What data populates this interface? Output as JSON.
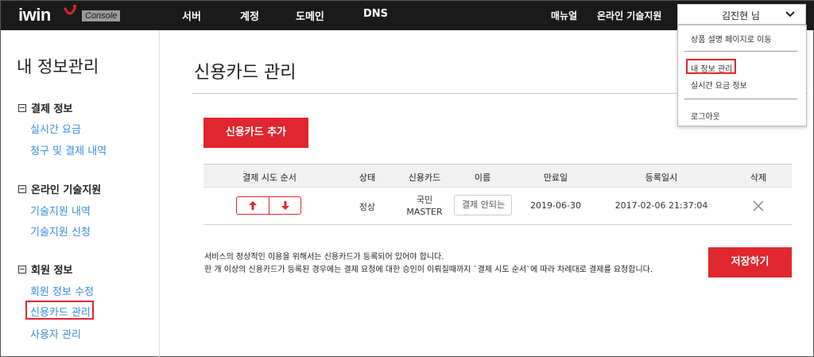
{
  "brand": {
    "logo_text": "iwin",
    "badge": "Console"
  },
  "nav": {
    "items": [
      "서버",
      "계정",
      "도메인",
      "DNS"
    ],
    "right": [
      "매뉴얼",
      "온라인 기술지원"
    ]
  },
  "account": {
    "name": "김진현 님"
  },
  "dropdown": {
    "items": [
      "상품 설명 페이지로 이동",
      "내 정보 관리",
      "실시간 요금 정보",
      "로그아웃"
    ]
  },
  "sidebar": {
    "title": "내 정보관리",
    "groups": [
      {
        "label": "결제 정보",
        "links": [
          "실시간 요금",
          "청구 및 결제 내역"
        ]
      },
      {
        "label": "온라인 기술지원",
        "links": [
          "기술지원 내역",
          "기술지원 신청"
        ]
      },
      {
        "label": "회원 정보",
        "links": [
          "회원 정보 수정",
          "신용카드 관리",
          "사용자 관리"
        ]
      }
    ]
  },
  "main": {
    "title": "신용카드 관리",
    "add_button": "신용카드 추가",
    "table": {
      "headers": [
        "결제 시도 순서",
        "상태",
        "신용카드",
        "이름",
        "만료일",
        "등록일시",
        "삭제"
      ],
      "rows": [
        {
          "status": "정상",
          "card_line1": "국민",
          "card_line2": "MASTER",
          "name": "결제 안되는",
          "expiry": "2019-06-30",
          "registered": "2017-02-06 21:37:04"
        }
      ]
    },
    "notice_line1": "서비스의 정상적인 이용을 위해서는 신용카드가 등록되어 있어야 합니다.",
    "notice_line2": "한 개 이상의 신용카드가 등록된 경우에는 결제 요청에 대한 승인이 이뤄질때까지 `결제 시도 순서`에 따라 차례대로 결제를 요청합니다.",
    "save_button": "저장하기"
  },
  "colors": {
    "accent": "#e0262e",
    "link": "#3a8dde",
    "topbar": "#1a1a1a"
  },
  "icons": [
    "smile-icon",
    "chevron-down-icon",
    "arrow-up-icon",
    "arrow-down-icon",
    "close-icon",
    "collapse-box-icon"
  ]
}
